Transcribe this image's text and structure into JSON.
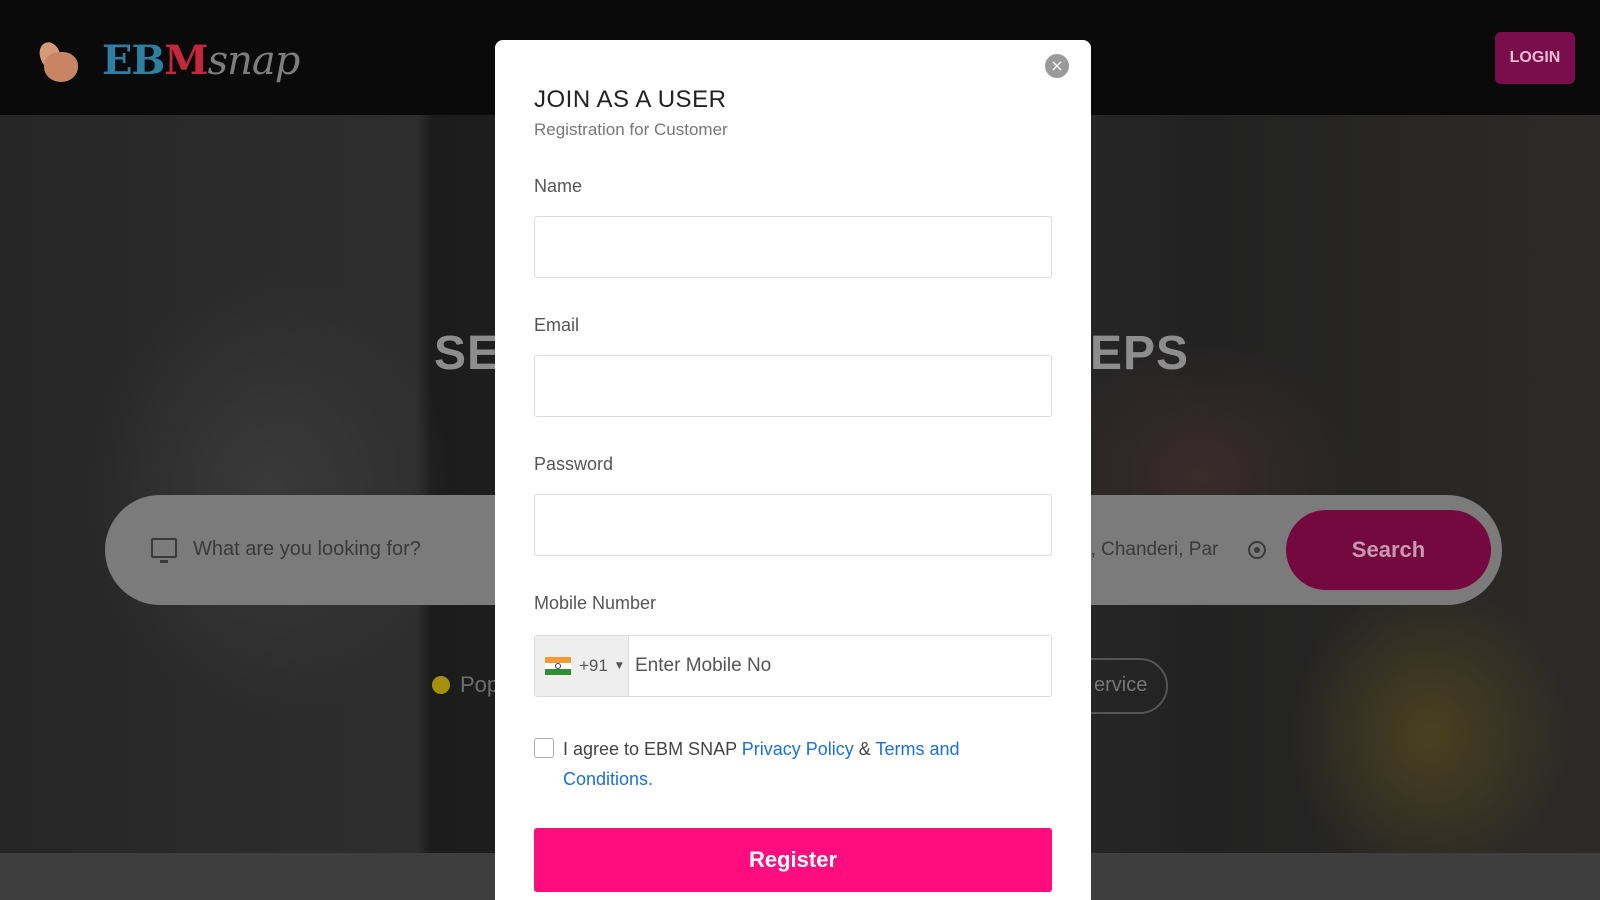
{
  "header": {
    "logo_text_part1": "EB",
    "logo_text_part2": "M",
    "logo_text_part3": "snap",
    "login_label": "LOGIN"
  },
  "hero": {
    "title_left": "SE",
    "title_right": "EPS",
    "search_placeholder": "What are you looking for?",
    "location_value": "d, Chanderi, Par",
    "search_button_label": "Search",
    "popular_label": "Pop",
    "service_chip_label": "ervice"
  },
  "modal": {
    "title": "JOIN AS A USER",
    "subtitle": "Registration for Customer",
    "close_symbol": "×",
    "name_label": "Name",
    "name_value": "",
    "email_label": "Email",
    "email_value": "",
    "password_label": "Password",
    "password_value": "",
    "mobile_label": "Mobile Number",
    "dial_code": "+91",
    "mobile_placeholder": "Enter Mobile No",
    "agree_prefix": "I agree to EBM SNAP ",
    "privacy_link": "Privacy Policy",
    "agree_and": " & ",
    "terms_link": "Terms and Conditions.",
    "agree_checked": false,
    "register_label": "Register"
  },
  "colors": {
    "accent_pink": "#ff0d7f",
    "link_blue": "#1b6fd6",
    "login_bg": "#7a0d4b"
  },
  "icons": [
    "monitor-icon",
    "crosshair-icon",
    "close-icon",
    "india-flag-icon",
    "caret-down-icon"
  ]
}
